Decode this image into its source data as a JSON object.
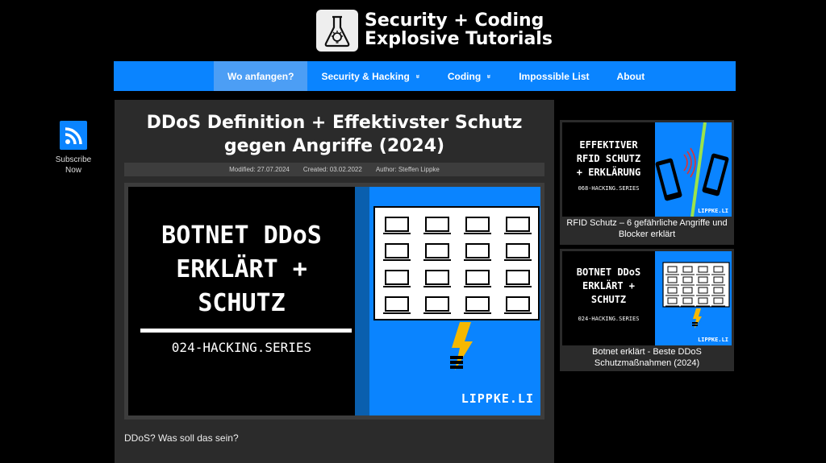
{
  "site": {
    "title_line1": "Security + Coding",
    "title_line2": "Explosive Tutorials"
  },
  "nav": {
    "items": [
      {
        "label": "Wo anfangen?",
        "active": true,
        "has_dropdown": false
      },
      {
        "label": "Security & Hacking",
        "active": false,
        "has_dropdown": true
      },
      {
        "label": "Coding",
        "active": false,
        "has_dropdown": true
      },
      {
        "label": "Impossible List",
        "active": false,
        "has_dropdown": false
      },
      {
        "label": "About",
        "active": false,
        "has_dropdown": false
      }
    ],
    "dropdown_glyph": "»"
  },
  "subscribe": {
    "icon": "rss-icon",
    "label_line1": "Subscribe",
    "label_line2": "Now"
  },
  "article": {
    "title_line1": "DDoS Definition + Effektivster Schutz",
    "title_line2": "gegen Angriffe (2024)",
    "modified": "Modified: 27.07.2024",
    "created": "Created: 03.02.2022",
    "author": "Author: Steffen Lippke",
    "hero": {
      "line1": "BOTNET DDoS",
      "line2": "ERKLÄRT +",
      "line3": "SCHUTZ",
      "series": "024-HACKING.SERIES",
      "brand": "LIPPKE.LI"
    },
    "intro": "DDoS? Was soll das sein?"
  },
  "sidebar": {
    "cards": [
      {
        "thumb_line1": "EFFEKTIVER",
        "thumb_line2": "RFID SCHUTZ",
        "thumb_line3": "+ ERKLÄRUNG",
        "thumb_series": "068-HACKING.SERIES",
        "thumb_brand": "LIPPKE.LI",
        "caption": "RFID Schutz – 6 gefährliche Angriffe und Blocker erklärt"
      },
      {
        "thumb_line1": "BOTNET DDoS",
        "thumb_line2": "ERKLÄRT +",
        "thumb_line3": "SCHUTZ",
        "thumb_series": "024-HACKING.SERIES",
        "thumb_brand": "LIPPKE.LI",
        "caption": "Botnet erklärt - Beste DDoS Schutzmaßnahmen (2024)"
      }
    ]
  },
  "colors": {
    "accent": "#0a84ff",
    "nav_active": "#4c9ef5",
    "card_bg": "#2b2b2b",
    "bolt": "#f5b800"
  }
}
